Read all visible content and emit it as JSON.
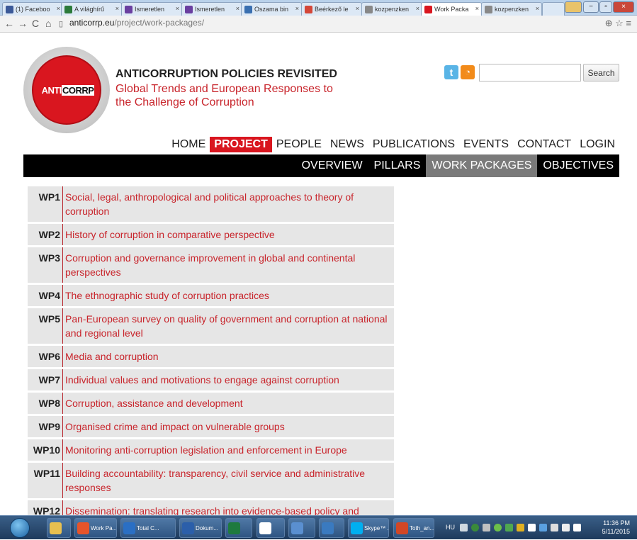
{
  "browser": {
    "tabs": [
      {
        "label": "(1) Faceboo",
        "color": "#3b5998"
      },
      {
        "label": "A világhírű",
        "color": "#2b7a3a"
      },
      {
        "label": "Ismeretlen",
        "color": "#6a3fa0"
      },
      {
        "label": "Ismeretlen",
        "color": "#6a3fa0"
      },
      {
        "label": "Oszama bin",
        "color": "#3a6fb0"
      },
      {
        "label": "Beérkező le",
        "color": "#d44638"
      },
      {
        "label": "kozpenzken",
        "color": "#888888"
      },
      {
        "label": "Work Packa",
        "color": "#d9161f"
      },
      {
        "label": "kozpenzken",
        "color": "#888888"
      }
    ],
    "url_host": "anticorrp.eu",
    "url_path": "/project/work-packages/"
  },
  "site": {
    "logo_anti": "ANTI",
    "logo_corrp": "CORRP",
    "title": "ANTICORRUPTION POLICIES REVISITED",
    "subtitle": "Global Trends and European Responses to the Challenge of Corruption",
    "search_button": "Search",
    "search_placeholder": ""
  },
  "main_nav": [
    "HOME",
    "PROJECT",
    "PEOPLE",
    "NEWS",
    "PUBLICATIONS",
    "EVENTS",
    "CONTACT",
    "LOGIN"
  ],
  "main_nav_active": "PROJECT",
  "sub_nav": [
    "OVERVIEW",
    "PILLARS",
    "WORK PACKAGES",
    "OBJECTIVES"
  ],
  "sub_nav_active": "WORK PACKAGES",
  "work_packages": [
    {
      "code": "WP1",
      "title": "Social, legal, anthropological and political approaches to theory of corruption"
    },
    {
      "code": "WP2",
      "title": "History of corruption in comparative perspective"
    },
    {
      "code": "WP3",
      "title": "Corruption and governance improvement in global and continental perspectives"
    },
    {
      "code": "WP4",
      "title": "The ethnographic study of corruption practices"
    },
    {
      "code": "WP5",
      "title": "Pan-European survey on quality of government and corruption at national and regional level"
    },
    {
      "code": "WP6",
      "title": "Media and corruption"
    },
    {
      "code": "WP7",
      "title": "Individual values and motivations to engage against corruption"
    },
    {
      "code": "WP8",
      "title": "Corruption, assistance and development"
    },
    {
      "code": "WP9",
      "title": "Organised crime and impact on vulnerable groups"
    },
    {
      "code": "WP10",
      "title": "Monitoring anti-corruption legislation and enforcement in Europe"
    },
    {
      "code": "WP11",
      "title": "Building accountability: transparency, civil service and administrative responses"
    },
    {
      "code": "WP12",
      "title": "Dissemination: translating research into evidence-based policy and informing stakeholders"
    }
  ],
  "taskbar": {
    "buttons": [
      {
        "label": "Work Pa...",
        "color": "#e7542a"
      },
      {
        "label": "Total C...",
        "color": "#2a6fc4"
      },
      {
        "label": "Dokum...",
        "color": "#2b5faa"
      },
      {
        "label": "",
        "color": "#1e7a3e"
      },
      {
        "label": "",
        "color": "#ffffff"
      },
      {
        "label": "",
        "color": "#5a8fd0"
      },
      {
        "label": "",
        "color": "#3a7ac0"
      },
      {
        "label": "Skype™ ...",
        "color": "#00aff0"
      },
      {
        "label": "Toth_an...",
        "color": "#d24726"
      }
    ],
    "lang": "HU",
    "time": "11:36 PM",
    "date": "5/11/2015"
  }
}
